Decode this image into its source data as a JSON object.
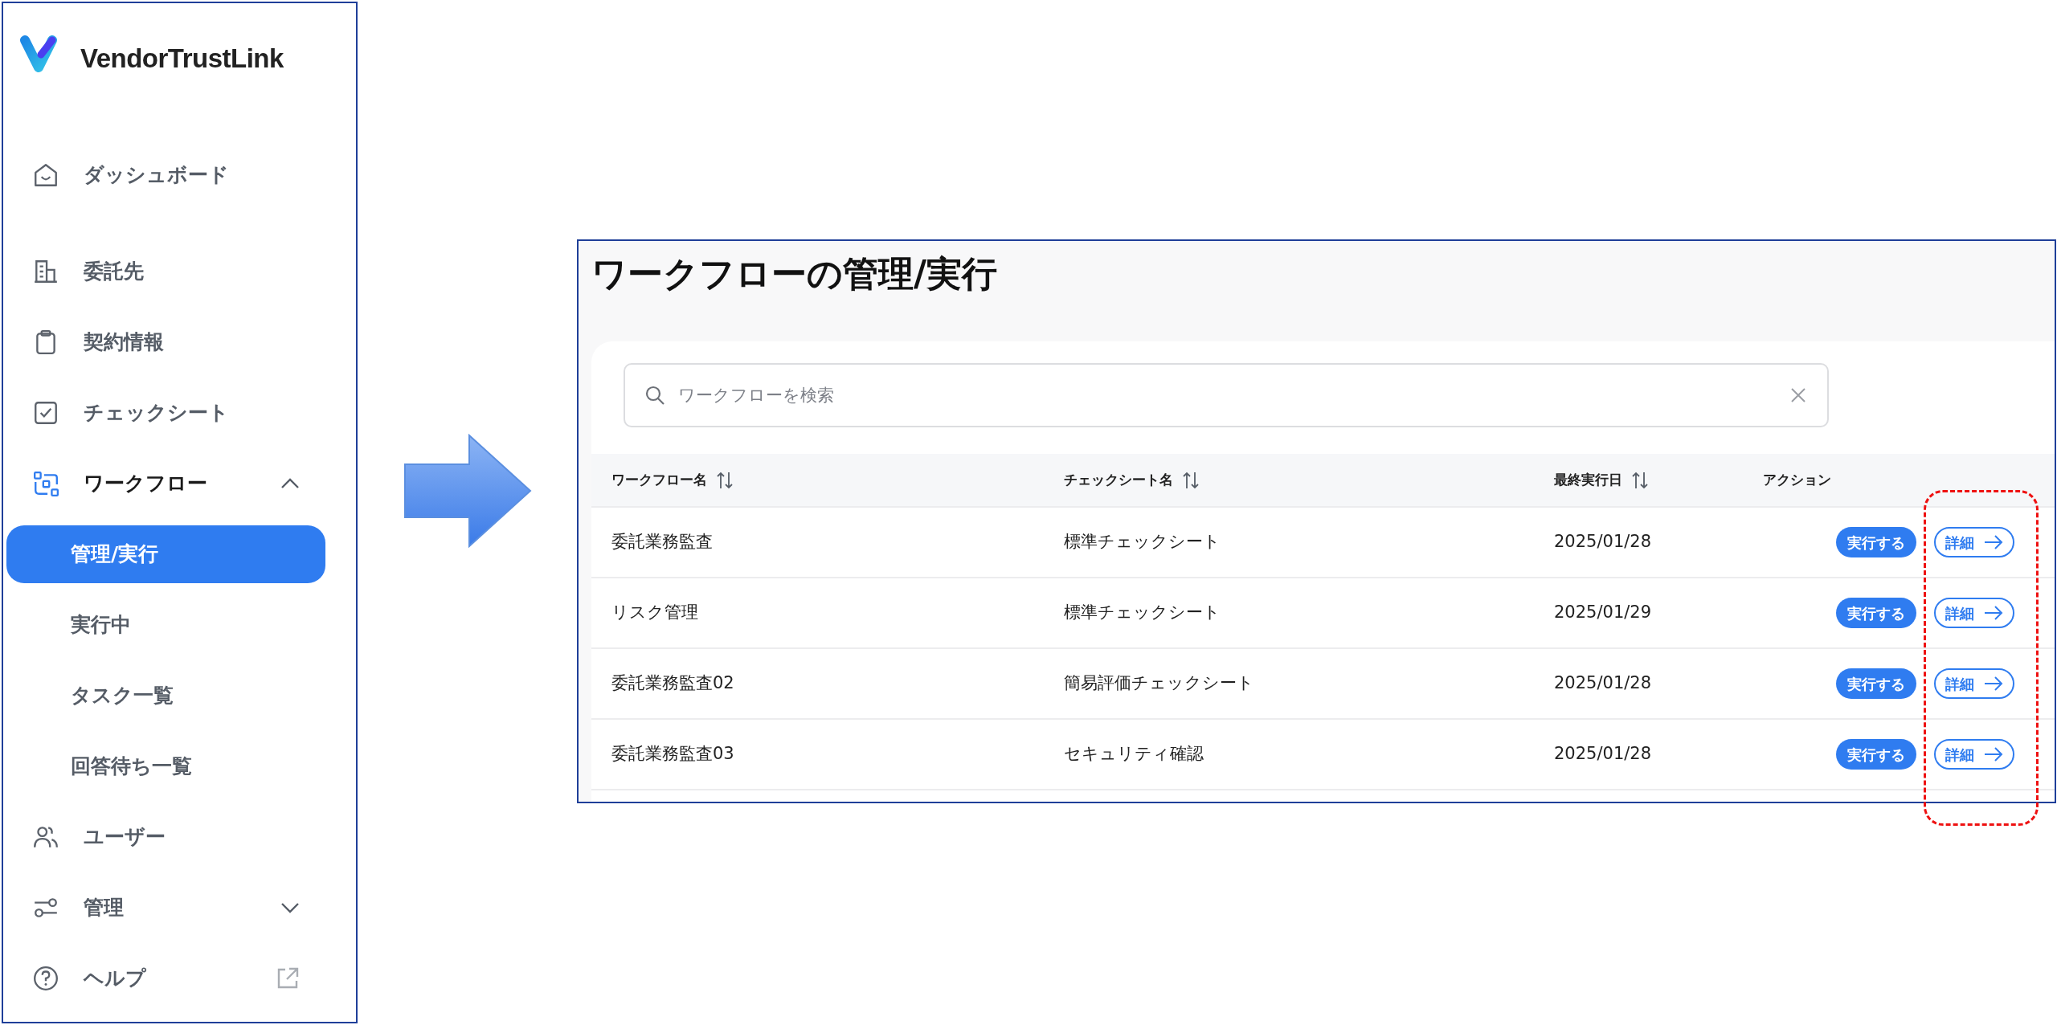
{
  "sidebar": {
    "logo_text": "VendorTrustLink",
    "items": [
      {
        "label": "ダッシュボード",
        "kind": "link",
        "selected": false
      },
      {
        "label": "委託先",
        "kind": "link",
        "selected": false
      },
      {
        "label": "契約情報",
        "kind": "link",
        "selected": false
      },
      {
        "label": "チェックシート",
        "kind": "link",
        "selected": false
      },
      {
        "label": "ワークフロー",
        "kind": "group",
        "expanded": true,
        "children": [
          {
            "label": "管理/実行",
            "selected": true
          },
          {
            "label": "実行中",
            "selected": false
          },
          {
            "label": "タスク一覧",
            "selected": false
          },
          {
            "label": "回答待ち一覧",
            "selected": false
          }
        ]
      },
      {
        "label": "ユーザー",
        "kind": "link",
        "selected": false
      },
      {
        "label": "管理",
        "kind": "group",
        "expanded": false
      },
      {
        "label": "ヘルプ",
        "kind": "external",
        "selected": false
      }
    ]
  },
  "page": {
    "title": "ワークフローの管理/実行",
    "search": {
      "placeholder": "ワークフローを検索"
    },
    "table": {
      "columns": [
        {
          "label": "ワークフロー名",
          "sortable": true
        },
        {
          "label": "チェックシート名",
          "sortable": true
        },
        {
          "label": "最終実行日",
          "sortable": true
        },
        {
          "label": "アクション",
          "sortable": false
        }
      ],
      "rows": [
        {
          "workflow": "委託業務監査",
          "checksheet": "標準チェックシート",
          "last_run": "2025/01/28",
          "run_button": "実行する",
          "detail_button": "詳細"
        },
        {
          "workflow": "リスク管理",
          "checksheet": "標準チェックシート",
          "last_run": "2025/01/29",
          "run_button": "実行する",
          "detail_button": "詳細"
        },
        {
          "workflow": "委託業務監査02",
          "checksheet": "簡易評価チェックシート",
          "last_run": "2025/01/28",
          "run_button": "実行する",
          "detail_button": "詳細"
        },
        {
          "workflow": "委託業務監査03",
          "checksheet": "セキュリティ確認",
          "last_run": "2025/01/28",
          "run_button": "実行する",
          "detail_button": "詳細"
        }
      ]
    }
  }
}
